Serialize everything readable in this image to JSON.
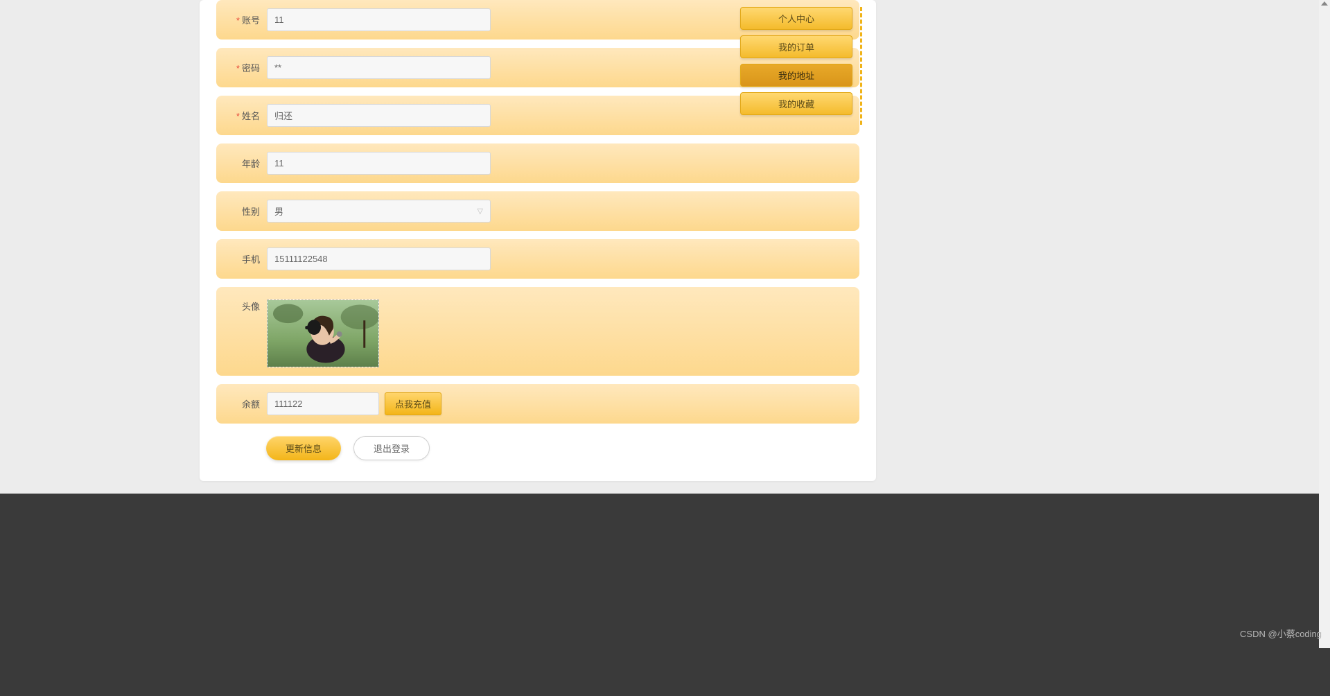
{
  "form": {
    "account": {
      "label": "账号",
      "value": "11",
      "required": true
    },
    "password": {
      "label": "密码",
      "value": "**",
      "required": true
    },
    "name": {
      "label": "姓名",
      "value": "归还",
      "required": true
    },
    "age": {
      "label": "年龄",
      "value": "11",
      "required": false
    },
    "gender": {
      "label": "性别",
      "value": "男",
      "required": false
    },
    "phone": {
      "label": "手机",
      "value": "15111122548",
      "required": false
    },
    "avatar": {
      "label": "头像",
      "required": false
    },
    "balance": {
      "label": "余额",
      "value": "111122",
      "required": false
    }
  },
  "buttons": {
    "recharge": "点我充值",
    "update": "更新信息",
    "logout": "退出登录"
  },
  "sidebar": {
    "items": [
      {
        "label": "个人中心",
        "active": false
      },
      {
        "label": "我的订单",
        "active": false
      },
      {
        "label": "我的地址",
        "active": true
      },
      {
        "label": "我的收藏",
        "active": false
      }
    ]
  },
  "watermark": "CSDN @小蔡coding"
}
